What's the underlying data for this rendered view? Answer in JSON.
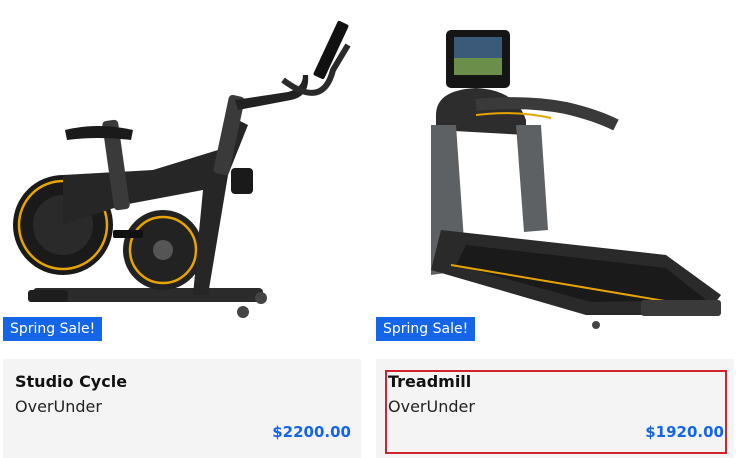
{
  "products": [
    {
      "title": "Studio Cycle",
      "brand": "OverUnder",
      "price": "$2200.00",
      "badge": "Spring Sale!",
      "image_icon": "exercise-bike-icon"
    },
    {
      "title": "Treadmill",
      "brand": "OverUnder",
      "price": "$1920.00",
      "badge": "Spring Sale!",
      "image_icon": "treadmill-icon"
    }
  ],
  "colors": {
    "badge": "#1565e8",
    "price": "#1565e8",
    "card_background": "#f4f4f4",
    "selection_outline": "#d0232a",
    "accent_yellow": "#e6a400"
  }
}
